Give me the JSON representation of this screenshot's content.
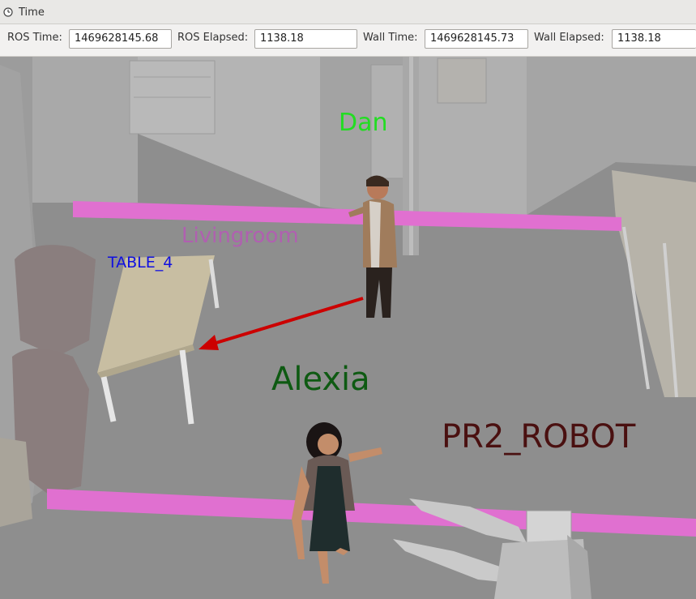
{
  "panel": {
    "title": "Time",
    "icon": "clock-icon"
  },
  "time_bar": {
    "ros_time_label": "ROS Time:",
    "ros_time_value": "1469628145.68",
    "ros_elapsed_label": "ROS Elapsed:",
    "ros_elapsed_value": "1138.18",
    "wall_time_label": "Wall Time:",
    "wall_time_value": "1469628145.73",
    "wall_elapsed_label": "Wall Elapsed:",
    "wall_elapsed_value": "1138.18"
  },
  "scene": {
    "labels": {
      "dan": "Dan",
      "livingroom": "Livingroom",
      "table": "TABLE_4",
      "alexia": "Alexia",
      "robot": "PR2_ROBOT"
    },
    "colors": {
      "dan": "#22dd22",
      "livingroom": "#b060b0",
      "table": "#1010e0",
      "alexia": "#0e5a12",
      "robot": "#4a1010",
      "zone_band": "#e070d0",
      "arrow": "#cc0000"
    }
  }
}
